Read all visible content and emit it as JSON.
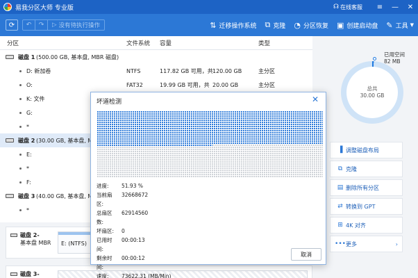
{
  "titlebar": {
    "title": "易我分区大师 专业版",
    "support": "在线客服"
  },
  "toolbar": {
    "pending_ops": "没有待执行操作",
    "actions": [
      {
        "label": "迁移操作系统",
        "icon": "migrate-os-icon"
      },
      {
        "label": "克隆",
        "icon": "clone-icon"
      },
      {
        "label": "分区恢复",
        "icon": "partition-recovery-icon"
      },
      {
        "label": "创建启动盘",
        "icon": "boot-disk-icon"
      },
      {
        "label": "工具",
        "icon": "tools-icon"
      }
    ]
  },
  "table": {
    "headers": {
      "partition": "分区",
      "filesystem": "文件系统",
      "capacity": "容量",
      "type": "类型"
    },
    "rows": [
      {
        "kind": "disk",
        "name": "磁盘 1",
        "detail": "(500.00 GB, 基本盘, MBR 磁盘)"
      },
      {
        "kind": "part",
        "name": "D: 新加卷",
        "fs": "NTFS",
        "cap_used": "117.82 GB 可用，共",
        "cap_total": "120.00 GB",
        "type": "主分区"
      },
      {
        "kind": "part",
        "name": "O:",
        "fs": "FAT32",
        "cap_used": "19.99 GB 可用，共",
        "cap_total": "20.00 GB",
        "type": "主分区"
      },
      {
        "kind": "part",
        "name": "K: 文件",
        "fs": "",
        "cap_used": "",
        "cap_total": "",
        "type": ""
      },
      {
        "kind": "part",
        "name": "G:",
        "fs": "",
        "cap_used": "",
        "cap_total": "",
        "type": ""
      },
      {
        "kind": "part",
        "name": "*",
        "fs": "",
        "cap_used": "",
        "cap_total": "",
        "type": ""
      },
      {
        "kind": "disk",
        "name": "磁盘 2",
        "detail": "(30.00 GB, 基本盘, MBR"
      },
      {
        "kind": "part",
        "name": "E:",
        "fs": "",
        "cap_used": "",
        "cap_total": "",
        "type": ""
      },
      {
        "kind": "part",
        "name": "*",
        "fs": "",
        "cap_used": "",
        "cap_total": "",
        "type": ""
      },
      {
        "kind": "part",
        "name": "F:",
        "fs": "",
        "cap_used": "",
        "cap_total": "",
        "type": ""
      },
      {
        "kind": "disk",
        "name": "磁盘 3",
        "detail": "(40.00 GB, 基本盘, MBR 磁盘)"
      },
      {
        "kind": "part",
        "name": "*",
        "fs": "",
        "cap_used": "",
        "cap_total": "",
        "type": ""
      }
    ]
  },
  "disk_map": [
    {
      "name": "磁盘 2-",
      "detail1": "基本盘 MBR",
      "detail2": "",
      "segment": "E: (NTFS)"
    },
    {
      "name": "磁盘 3-",
      "detail1": "",
      "detail2": "",
      "segment": ""
    }
  ],
  "right_panel": {
    "used_label": "已用空间",
    "used_value": "82 MB",
    "total_label": "总共",
    "total_value": "30.00 GB",
    "used_fraction": 0.0027,
    "actions": [
      {
        "label": "调整磁盘布局",
        "icon": "adjust-layout-icon"
      },
      {
        "label": "克隆",
        "icon": "clone-icon"
      },
      {
        "label": "删除所有分区",
        "icon": "delete-partitions-icon"
      },
      {
        "label": "转换到 GPT",
        "icon": "convert-gpt-icon"
      },
      {
        "label": "4K 对齐",
        "icon": "align-4k-icon"
      },
      {
        "label": "更多",
        "icon": "more-icon"
      }
    ]
  },
  "dialog": {
    "title": "坏道检测",
    "progress_fraction": 0.5193,
    "stats": [
      {
        "key": "进度:",
        "value": "51.93 %"
      },
      {
        "key": "当前扇区:",
        "value": "32668672"
      },
      {
        "key": "总扇区数:",
        "value": "62914560"
      },
      {
        "key": "坏扇区:",
        "value": "0"
      },
      {
        "key": "已用时间:",
        "value": "00:00:13"
      },
      {
        "key": "剩余时间:",
        "value": "00:00:12"
      },
      {
        "key": "速度:",
        "value": "73622.31 (MB/Min)"
      }
    ],
    "cancel_label": "取消"
  },
  "colors": {
    "titlebar": "#1d63c5",
    "toolbar": "#2c78d6",
    "scan_done": "#2e7bd9",
    "scan_todo": "#cfd3d8"
  }
}
